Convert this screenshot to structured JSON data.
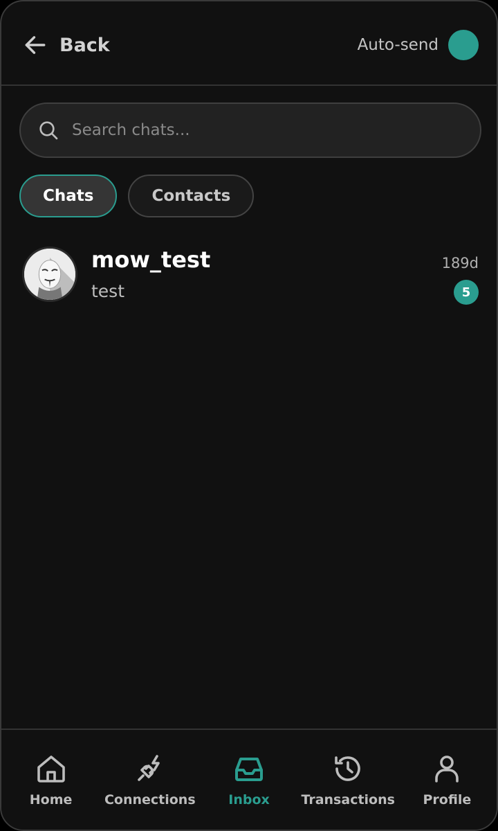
{
  "header": {
    "back_label": "Back",
    "autosend_label": "Auto-send"
  },
  "search": {
    "placeholder": "Search chats...",
    "value": ""
  },
  "tabs": [
    {
      "label": "Chats",
      "active": true
    },
    {
      "label": "Contacts",
      "active": false
    }
  ],
  "chats": [
    {
      "name": "mow_test",
      "preview": "test",
      "time": "189d",
      "unread": "5"
    }
  ],
  "nav": {
    "items": [
      {
        "label": "Home",
        "icon": "home-icon"
      },
      {
        "label": "Connections",
        "icon": "plug-icon"
      },
      {
        "label": "Inbox",
        "icon": "inbox-icon",
        "active": true
      },
      {
        "label": "Transactions",
        "icon": "history-icon"
      },
      {
        "label": "Profile",
        "icon": "user-icon"
      }
    ]
  },
  "colors": {
    "accent": "#2a9d8f",
    "background": "#111111",
    "surface": "#222222"
  }
}
